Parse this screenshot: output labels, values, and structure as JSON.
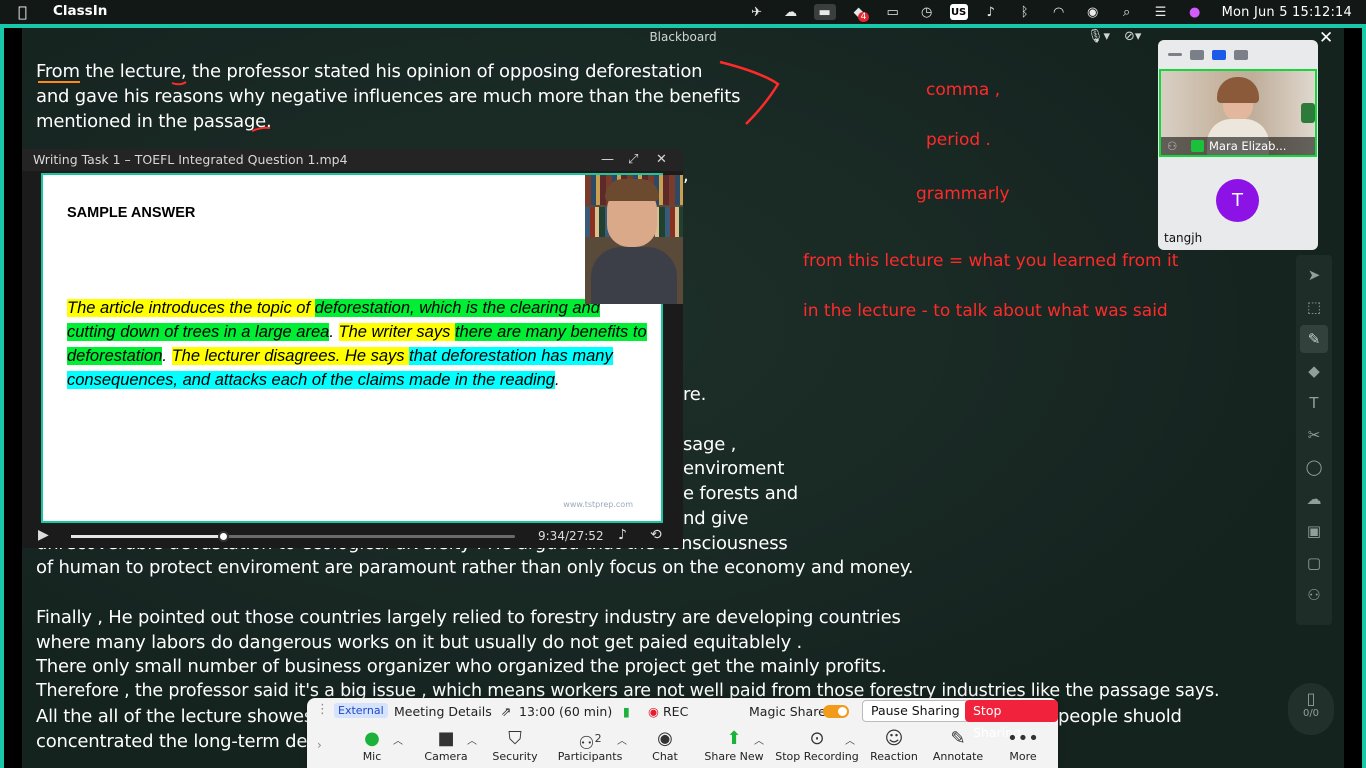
{
  "menubar": {
    "app_name": "ClassIn",
    "clock": "Mon Jun 5  15:12:14",
    "input_source": "US",
    "notification_badge": "4"
  },
  "blackboard": {
    "title": "Blackboard",
    "lines": [
      "From the lecture, the professor stated his opinion of opposing deforestation",
      "and gave his reasons why negative influences are much more than the benefits",
      "mentioned in the passage.",
      ",",
      "re.",
      "sage ,",
      " enviroment",
      "e forests and",
      "nd give",
      "unrecoverable devastation to ecological diversity . He argued that the consciousness",
      "of human to protect enviroment are paramount rather than only focus on the economy and money.",
      "Finally , He pointed out those countries largely relied to forestry industry are developing countries",
      " where many labors do dangerous works on it but usually do not get paied equitablely .",
      "There only small number of business organizer who organized the project get the mainly profits.",
      "Therefore , the professor said it's a big issue , which means workers are not well paid from those forestry industries like the passage says.",
      "All the all of the lecture showes",
      "people shuold",
      " concentrated the long-term dev"
    ],
    "notes": [
      "comma ,",
      "period .",
      "grammarly",
      "from this lecture = what you learned from it",
      "in the lecture - to talk about what was said"
    ],
    "page_counter": "0/0"
  },
  "video": {
    "title": "Writing Task 1 – TOEFL Integrated Question 1.mp4",
    "slide_title": "SAMPLE ANSWER",
    "segments": [
      {
        "text": "The article introduces the topic of ",
        "hl": "y"
      },
      {
        "text": "deforestation, which is the clearing and cutting down of trees in a large area",
        "hl": "g"
      },
      {
        "text": ". ",
        "hl": ""
      },
      {
        "text": "The writer says ",
        "hl": "y"
      },
      {
        "text": "there are many benefits to deforestation",
        "hl": "g"
      },
      {
        "text": ". ",
        "hl": ""
      },
      {
        "text": "The lecturer disagrees. He says ",
        "hl": "y"
      },
      {
        "text": "that deforestation has many consequences, and attacks each of the claims made in the reading",
        "hl": "c"
      },
      {
        "text": ".",
        "hl": ""
      }
    ],
    "footer": "www.tstprep.com",
    "time": "9:34/27:52",
    "progress": 0.343
  },
  "participants": {
    "me_label": "Mara Elizab... (Me)",
    "other_initial": "T",
    "other_name": "tangjh"
  },
  "zoom": {
    "external": "External",
    "meeting_details": "Meeting Details",
    "duration": "13:00  (60 min)",
    "rec": "REC",
    "magic_share": "Magic Share",
    "pause_sharing": "Pause Sharing",
    "stop_sharing": "Stop Sharing",
    "buttons": {
      "mic": "Mic",
      "camera": "Camera",
      "security": "Security",
      "participants": "Participants",
      "participants_count": "2",
      "chat": "Chat",
      "share_new": "Share New",
      "stop_recording": "Stop Recording",
      "reaction": "Reaction",
      "annotate": "Annotate",
      "more": "More"
    }
  }
}
